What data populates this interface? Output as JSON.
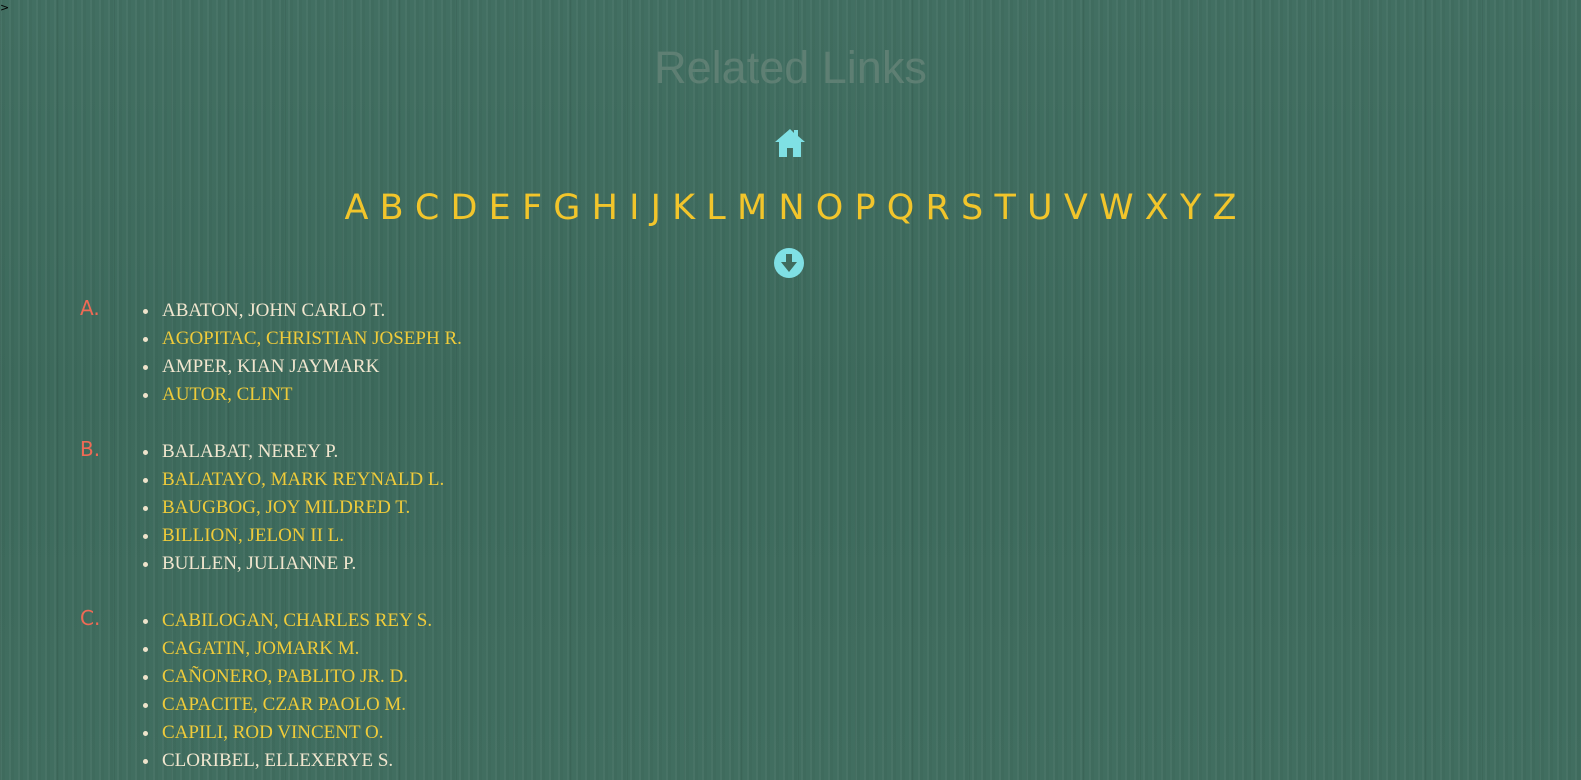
{
  "stray_glyph": ">",
  "title": "Related Links",
  "icons": {
    "home": "home-icon",
    "down": "arrow-down-circle-icon",
    "icon_color": "#7fe0e4"
  },
  "colors": {
    "background": "#3f6b5e",
    "title": "#5e7f73",
    "alphabet": "#f2c52b",
    "section_letter": "#ef6a55",
    "name_cream": "#f1e6cf",
    "name_gold": "#efcb3a"
  },
  "alphabet": [
    "A",
    "B",
    "C",
    "D",
    "E",
    "F",
    "G",
    "H",
    "I",
    "J",
    "K",
    "L",
    "M",
    "N",
    "O",
    "P",
    "Q",
    "R",
    "S",
    "T",
    "U",
    "V",
    "W",
    "X",
    "Y",
    "Z"
  ],
  "sections": [
    {
      "letter": "A.",
      "names": [
        {
          "text": "ABATON, JOHN CARLO T.",
          "color": "cream"
        },
        {
          "text": "AGOPITAC, CHRISTIAN JOSEPH R.",
          "color": "gold"
        },
        {
          "text": "AMPER, KIAN JAYMARK",
          "color": "cream"
        },
        {
          "text": "AUTOR, CLINT",
          "color": "gold"
        }
      ]
    },
    {
      "letter": "B.",
      "names": [
        {
          "text": "BALABAT, NEREY P.",
          "color": "cream"
        },
        {
          "text": "BALATAYO, MARK REYNALD L.",
          "color": "gold"
        },
        {
          "text": "BAUGBOG, JOY MILDRED T.",
          "color": "gold"
        },
        {
          "text": "BILLION, JELON II L.",
          "color": "gold"
        },
        {
          "text": "BULLEN, JULIANNE P.",
          "color": "cream"
        }
      ]
    },
    {
      "letter": "C.",
      "names": [
        {
          "text": "CABILOGAN, CHARLES REY S.",
          "color": "gold"
        },
        {
          "text": "CAGATIN, JOMARK M.",
          "color": "gold"
        },
        {
          "text": "CAÑONERO, PABLITO JR. D.",
          "color": "gold"
        },
        {
          "text": "CAPACITE, CZAR PAOLO M.",
          "color": "gold"
        },
        {
          "text": "CAPILI, ROD VINCENT O.",
          "color": "gold"
        },
        {
          "text": "CLORIBEL, ELLEXERYE S.",
          "color": "cream"
        }
      ]
    }
  ]
}
